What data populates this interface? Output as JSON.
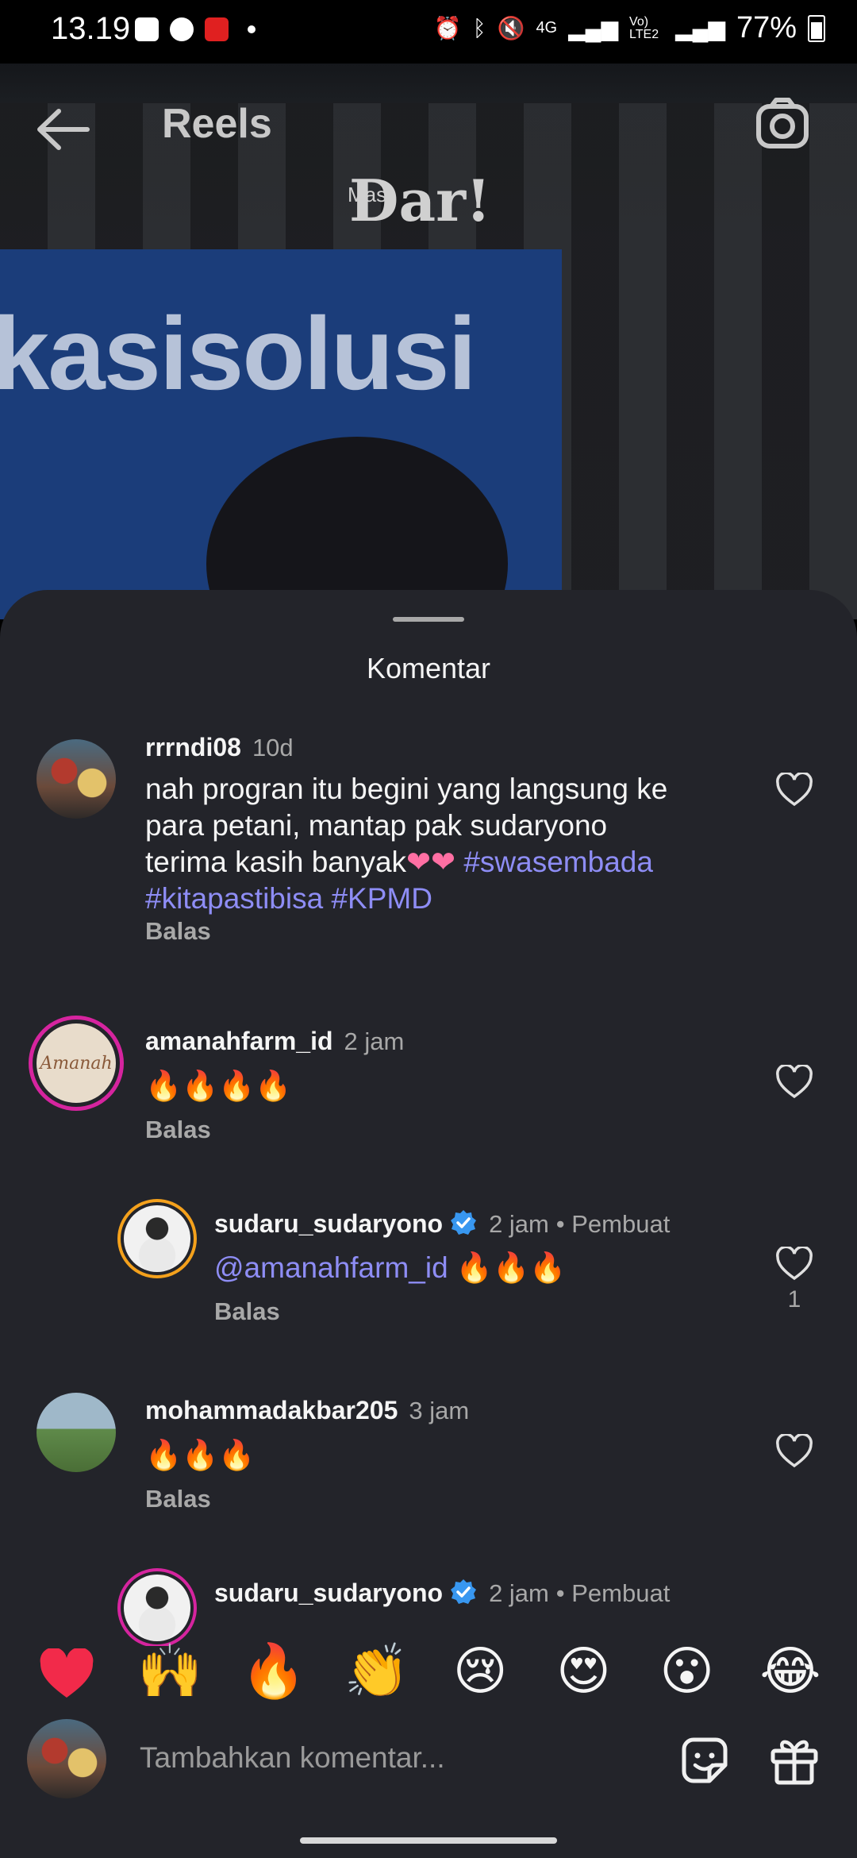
{
  "status_bar": {
    "time": "13.19",
    "battery": "77%",
    "network": "4G",
    "volte": "Vo) LTE2"
  },
  "header": {
    "title": "Reels",
    "back_icon": "arrow-left-icon",
    "camera_icon": "camera-icon"
  },
  "video": {
    "logo_prefix": "Mas",
    "logo": "Dar!",
    "panel_text": "kasisolusi"
  },
  "sheet": {
    "title": "Komentar"
  },
  "comments": [
    {
      "username": "rrrndi08",
      "time": "10d",
      "text_lines": [
        "nah progran itu begini yang langsung ke",
        "para petani, mantap pak sudaryono",
        "terima kasih banyak"
      ],
      "text_hearts": "❤❤",
      "hashtags_line3": "#swasembada",
      "hashtags_line4": "#kitapastibisa #KPMD",
      "reply_label": "Balas"
    },
    {
      "username": "amanahfarm_id",
      "time": "2 jam",
      "text": "🔥🔥🔥🔥",
      "avatar_text": "Amanah",
      "reply_label": "Balas"
    },
    {
      "username": "sudaru_sudaryono",
      "time": "2 jam",
      "badge": "• Pembuat",
      "mention": "@amanahfarm_id",
      "text": " 🔥🔥🔥",
      "reply_label": "Balas",
      "likes": "1"
    },
    {
      "username": "mohammadakbar205",
      "time": "3 jam",
      "text": "🔥🔥🔥",
      "reply_label": "Balas"
    },
    {
      "username": "sudaru_sudaryono",
      "time": "2 jam",
      "badge": "• Pembuat"
    }
  ],
  "emoji_bar": [
    "❤️",
    "🙌",
    "🔥",
    "👏",
    "😢",
    "😍",
    "😮",
    "😂"
  ],
  "input": {
    "placeholder": "Tambahkan komentar...",
    "sticker_icon": "sticker-icon",
    "gift_icon": "gift-icon"
  },
  "colors": {
    "sheet_bg": "#23242a",
    "link": "#8e8df5",
    "verified": "#3897f0",
    "story_ring": "#d6249f"
  }
}
